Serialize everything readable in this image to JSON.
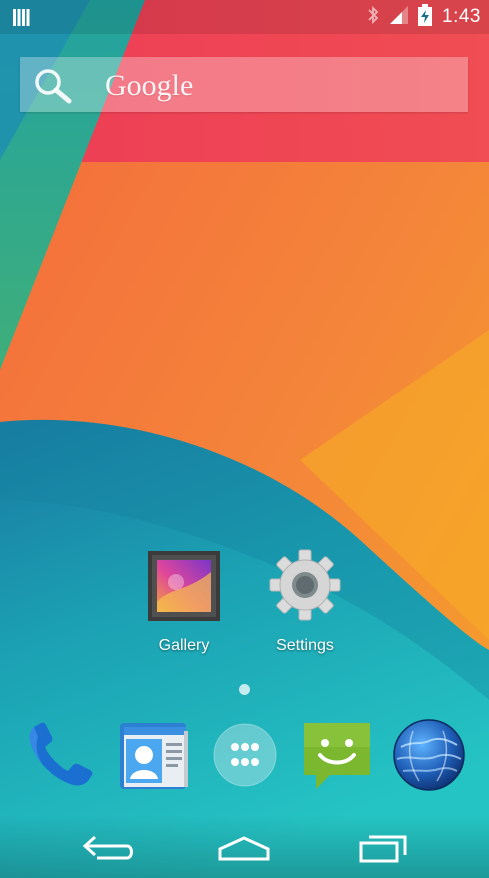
{
  "status_bar": {
    "time": "1:43",
    "icons": [
      "notification-icon",
      "bluetooth-icon",
      "signal-icon",
      "battery-charging-icon"
    ],
    "color": "#ffffff"
  },
  "search": {
    "brand": "Google",
    "icon": "search-icon"
  },
  "desktop_apps": [
    {
      "label": "Gallery",
      "icon": "gallery-icon"
    },
    {
      "label": "Settings",
      "icon": "settings-gear-icon"
    }
  ],
  "page_indicator": {
    "pages": 1,
    "current": 1
  },
  "hotseat": [
    {
      "icon": "phone-icon"
    },
    {
      "icon": "contacts-icon"
    },
    {
      "icon": "app-drawer-icon"
    },
    {
      "icon": "messaging-icon"
    },
    {
      "icon": "browser-globe-icon"
    }
  ],
  "nav_bar": {
    "buttons": [
      "back-icon",
      "home-icon",
      "recents-icon"
    ]
  },
  "colors": {
    "wallpaper_teal": "#1aa5b0",
    "wallpaper_orange": "#f27a3e",
    "wallpaper_red": "#ef4154",
    "wallpaper_yellow": "#f5a623",
    "wallpaper_green": "#3fae7a"
  }
}
